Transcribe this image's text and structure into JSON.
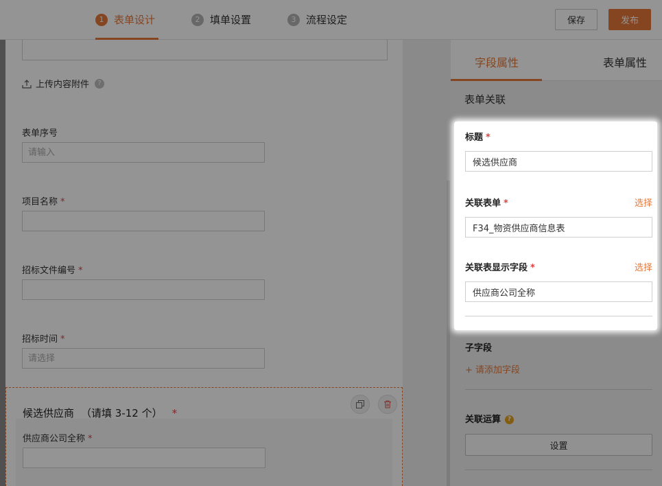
{
  "steps": [
    {
      "num": "1",
      "label": "表单设计"
    },
    {
      "num": "2",
      "label": "填单设置"
    },
    {
      "num": "3",
      "label": "流程设定"
    }
  ],
  "header": {
    "save": "保存",
    "publish": "发布"
  },
  "canvas": {
    "upload_label": "上传内容附件",
    "help_glyph": "?",
    "fields": [
      {
        "label": "表单序号",
        "placeholder": "请输入",
        "required": false
      },
      {
        "label": "项目名称",
        "placeholder": "",
        "required": true
      },
      {
        "label": "招标文件编号",
        "placeholder": "",
        "required": true
      },
      {
        "label": "招标时间",
        "placeholder": "请选择",
        "required": true
      }
    ],
    "subform": {
      "title": "候选供应商",
      "hint": "（请填 3-12 个）",
      "field_label": "供应商公司全称"
    },
    "required_mark": "*"
  },
  "panel": {
    "tabs": [
      "字段属性",
      "表单属性"
    ],
    "section": "表单关联",
    "title_label": "标题",
    "title_value": "候选供应商",
    "assoc_form_label": "关联表单",
    "assoc_form_value": "F34_物资供应商信息表",
    "assoc_field_label": "关联表显示字段",
    "assoc_field_value": "供应商公司全称",
    "select_link": "选择",
    "subfield_label": "子字段",
    "add_subfield": "+ 请添加字段",
    "calc_label": "关联运算",
    "calc_button": "设置"
  },
  "colors": {
    "accent": "#e5773a",
    "required": "#e04040"
  }
}
